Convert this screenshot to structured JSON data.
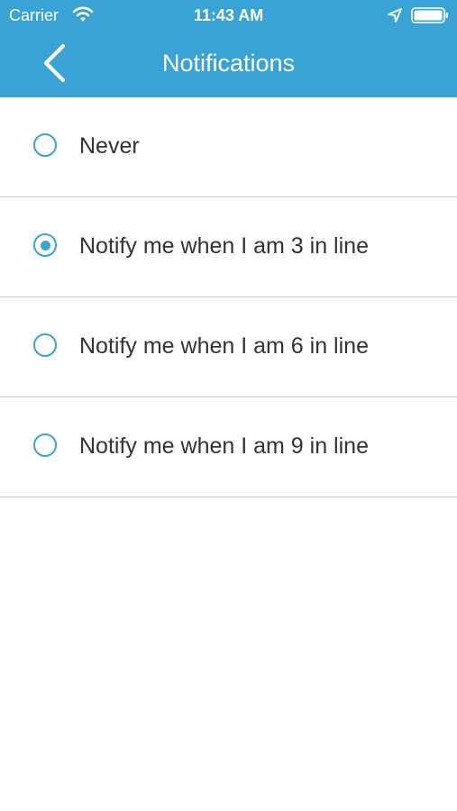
{
  "status_bar": {
    "carrier": "Carrier",
    "time": "11:43 AM",
    "icons": [
      "wifi-icon",
      "location-arrow-icon",
      "battery-icon"
    ]
  },
  "nav": {
    "back_icon": "chevron-left-icon",
    "title": "Notifications"
  },
  "options": [
    {
      "label": "Never",
      "selected": false
    },
    {
      "label": "Notify me when I am 3 in line",
      "selected": true
    },
    {
      "label": "Notify me when I am 6 in line",
      "selected": false
    },
    {
      "label": "Notify me when I am 9 in line",
      "selected": false
    }
  ],
  "colors": {
    "accent": "#38a3d4",
    "text": "#333333",
    "divider": "#c8c8c8"
  }
}
